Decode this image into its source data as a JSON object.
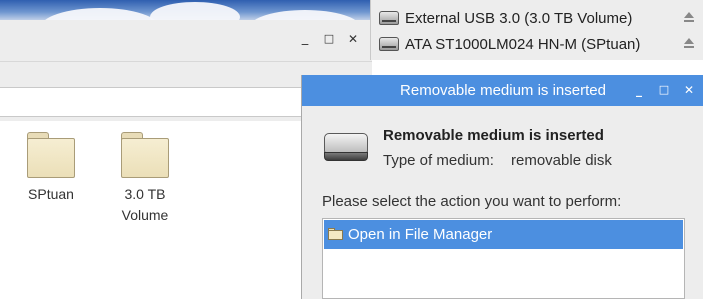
{
  "file_manager": {
    "controls": {
      "minimize": "_",
      "maximize": "□",
      "close": "✕"
    },
    "folders": [
      {
        "label_lines": [
          "SPtuan"
        ],
        "icon": "folder-icon"
      },
      {
        "label_lines": [
          "3.0 TB",
          "Volume"
        ],
        "icon": "folder-icon"
      }
    ]
  },
  "drives": [
    {
      "label": "External USB 3.0 (3.0 TB Volume)",
      "icon": "hard-drive-icon",
      "action_icon": "eject-icon"
    },
    {
      "label": "ATA ST1000LM024 HN-M (SPtuan)",
      "icon": "hard-drive-icon",
      "action_icon": "eject-icon"
    }
  ],
  "dialog": {
    "title": "Removable medium is inserted",
    "controls": {
      "minimize": "_",
      "maximize": "□",
      "close": "✕"
    },
    "heading": "Removable medium is inserted",
    "type_label": "Type of medium:",
    "type_value": "removable disk",
    "prompt": "Please select the action you want to perform:",
    "actions": [
      {
        "label": "Open in File Manager",
        "icon": "folder-icon",
        "selected": true
      }
    ]
  },
  "colors": {
    "accent": "#4c8fe0",
    "window_bg": "#ededed"
  }
}
